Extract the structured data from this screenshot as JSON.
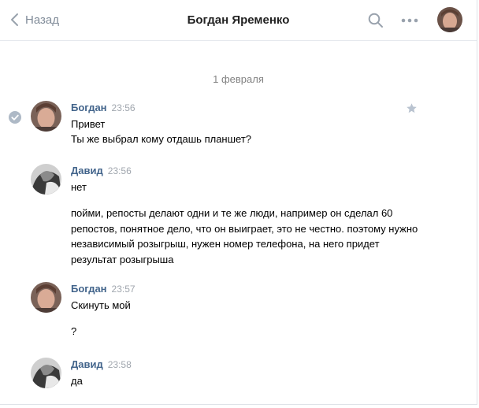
{
  "header": {
    "back_label": "Назад",
    "title": "Богдан Яременко",
    "icons": [
      "chevron-left-icon",
      "search-icon",
      "more-icon"
    ],
    "colors": {
      "link": "#42648b",
      "muted": "#818c99",
      "divider": "#e6e9ee"
    }
  },
  "date_separator": "1 февраля",
  "messages": [
    {
      "author": "Богдан",
      "time": "23:56",
      "lines": [
        "Привет",
        "Ты же выбрал кому отдашь планшет?"
      ]
    },
    {
      "author": "Давид",
      "time": "23:56",
      "lines": [
        "нет"
      ],
      "paragraph": "пойми, репосты делают одни и те же люди, например он сделал 60 репостов, понятное дело, что он выиграет, это не честно. поэтому нужно независимый розыгрыш, нужен номер телефона, на него придет результат розыгрыша"
    },
    {
      "author": "Богдан",
      "time": "23:57",
      "lines": [
        "Скинуть мой",
        "?"
      ]
    },
    {
      "author": "Давид",
      "time": "23:58",
      "lines": [
        "да"
      ]
    }
  ]
}
